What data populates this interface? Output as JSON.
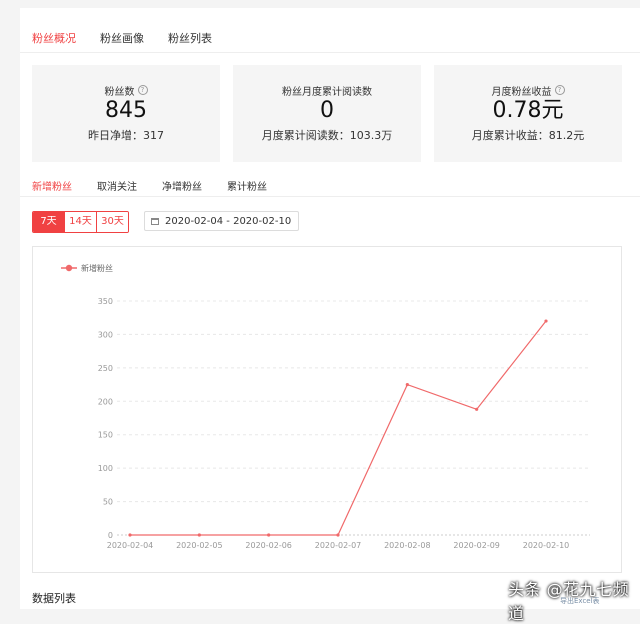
{
  "top_tabs": [
    {
      "label": "粉丝概况",
      "active": true
    },
    {
      "label": "粉丝画像",
      "active": false
    },
    {
      "label": "粉丝列表",
      "active": false
    }
  ],
  "cards": [
    {
      "label": "粉丝数",
      "value": "845",
      "sub": "昨日净增：317",
      "help": true
    },
    {
      "label": "粉丝月度累计阅读数",
      "value": "0",
      "sub": "月度累计阅读数：103.3万",
      "help": false
    },
    {
      "label": "月度粉丝收益",
      "value": "0.78元",
      "sub": "月度累计收益：81.2元",
      "help": true
    }
  ],
  "help_glyph": "?",
  "sub_tabs": [
    {
      "label": "新增粉丝",
      "active": true
    },
    {
      "label": "取消关注",
      "active": false
    },
    {
      "label": "净增粉丝",
      "active": false
    },
    {
      "label": "累计粉丝",
      "active": false
    }
  ],
  "ranges": [
    {
      "label": "7天",
      "active": true
    },
    {
      "label": "14天",
      "active": false
    },
    {
      "label": "30天",
      "active": false
    }
  ],
  "date_range": "2020-02-04 - 2020-02-10",
  "section_title": "数据列表",
  "watermark": "头条 @花九七频道",
  "watermark_sub": "导出Excel表",
  "colors": {
    "accent": "#f04142",
    "line": "#f0696a"
  },
  "chart_data": {
    "type": "line",
    "x": [
      "2020-02-04",
      "2020-02-05",
      "2020-02-06",
      "2020-02-07",
      "2020-02-08",
      "2020-02-09",
      "2020-02-10"
    ],
    "series": [
      {
        "name": "新增粉丝",
        "values": [
          0,
          0,
          0,
          0,
          225,
          188,
          320
        ]
      }
    ],
    "yticks": [
      0,
      50,
      100,
      150,
      200,
      250,
      300,
      350
    ],
    "ylim": [
      0,
      350
    ],
    "grid": true,
    "legend": "top-left"
  }
}
